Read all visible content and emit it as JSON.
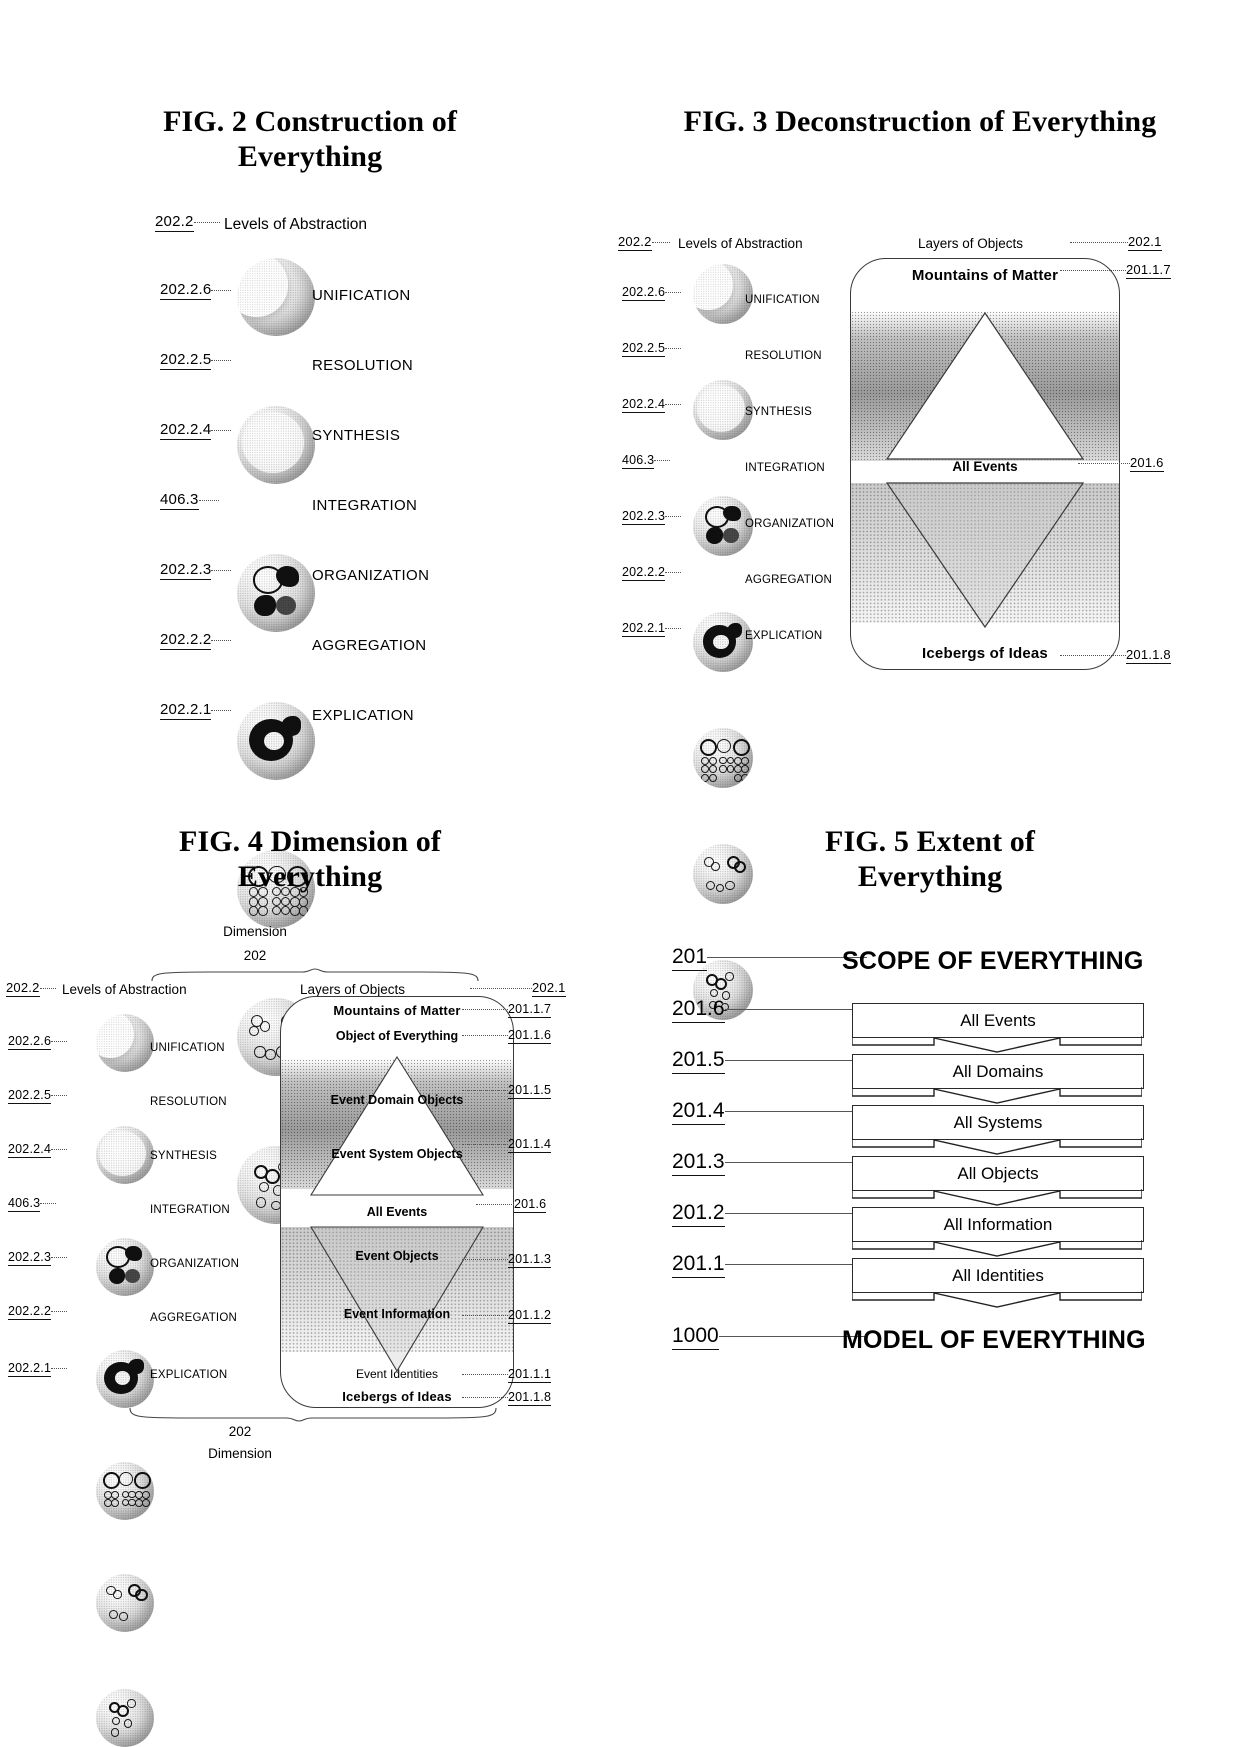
{
  "document": {
    "type": "patent-figure-sheet",
    "figure_count": 4
  },
  "fig2": {
    "title": "FIG. 2 Construction of Everything",
    "column_header": {
      "ref": "202.2",
      "label": "Levels of Abstraction"
    },
    "levels": [
      {
        "ref": "202.2.6",
        "label": "UNIFICATION"
      },
      {
        "ref": "202.2.5",
        "label": "RESOLUTION"
      },
      {
        "ref": "202.2.4",
        "label": "SYNTHESIS"
      },
      {
        "ref": "406.3",
        "label": "INTEGRATION"
      },
      {
        "ref": "202.2.3",
        "label": "ORGANIZATION"
      },
      {
        "ref": "202.2.2",
        "label": "AGGREGATION"
      },
      {
        "ref": "202.2.1",
        "label": "EXPLICATION"
      }
    ]
  },
  "fig3": {
    "title": "FIG. 3 Deconstruction of Everything",
    "left_column": {
      "ref": "202.2",
      "label": "Levels of Abstraction"
    },
    "right_column": {
      "ref": "202.1",
      "label": "Layers of Objects"
    },
    "levels": [
      {
        "ref": "202.2.6",
        "label": "UNIFICATION"
      },
      {
        "ref": "202.2.5",
        "label": "RESOLUTION"
      },
      {
        "ref": "202.2.4",
        "label": "SYNTHESIS"
      },
      {
        "ref": "406.3",
        "label": "INTEGRATION"
      },
      {
        "ref": "202.2.3",
        "label": "ORGANIZATION"
      },
      {
        "ref": "202.2.2",
        "label": "AGGREGATION"
      },
      {
        "ref": "202.2.1",
        "label": "EXPLICATION"
      }
    ],
    "bands": {
      "top_title": "Mountains of Matter",
      "top_ref": "201.1.7",
      "middle_title": "All Events",
      "middle_ref": "201.6",
      "bottom_title": "Icebergs of Ideas",
      "bottom_ref": "201.1.8"
    }
  },
  "fig4": {
    "title": "FIG. 4 Dimension of Everything",
    "dimension_top": {
      "label": "Dimension",
      "ref": "202"
    },
    "dimension_bottom": {
      "ref": "202",
      "label": "Dimension"
    },
    "left_column": {
      "ref": "202.2",
      "label": "Levels of Abstraction"
    },
    "right_column": {
      "ref": "202.1",
      "label": "Layers of Objects"
    },
    "levels": [
      {
        "ref": "202.2.6",
        "label": "UNIFICATION"
      },
      {
        "ref": "202.2.5",
        "label": "RESOLUTION"
      },
      {
        "ref": "202.2.4",
        "label": "SYNTHESIS"
      },
      {
        "ref": "406.3",
        "label": "INTEGRATION"
      },
      {
        "ref": "202.2.3",
        "label": "ORGANIZATION"
      },
      {
        "ref": "202.2.2",
        "label": "AGGREGATION"
      },
      {
        "ref": "202.2.1",
        "label": "EXPLICATION"
      }
    ],
    "layers": [
      {
        "ref": "201.1.7",
        "label": "Mountains of Matter"
      },
      {
        "ref": "201.1.6",
        "label": "Object of Everything"
      },
      {
        "ref": "201.1.5",
        "label": "Event Domain Objects"
      },
      {
        "ref": "201.1.4",
        "label": "Event System Objects"
      },
      {
        "ref": "201.6",
        "label": "All Events"
      },
      {
        "ref": "201.1.3",
        "label": "Event Objects"
      },
      {
        "ref": "201.1.2",
        "label": "Event Information"
      },
      {
        "ref": "201.1.1",
        "label": "Event Identities"
      },
      {
        "ref": "201.1.8",
        "label": "Icebergs of Ideas"
      }
    ]
  },
  "fig5": {
    "title": "FIG. 5 Extent of Everything",
    "scope": {
      "ref": "201",
      "label": "SCOPE OF EVERYTHING"
    },
    "model": {
      "ref": "1000",
      "label": "MODEL OF EVERYTHING"
    },
    "rows": [
      {
        "ref": "201.6",
        "label": "All Events"
      },
      {
        "ref": "201.5",
        "label": "All Domains"
      },
      {
        "ref": "201.4",
        "label": "All Systems"
      },
      {
        "ref": "201.3",
        "label": "All Objects"
      },
      {
        "ref": "201.2",
        "label": "All Information"
      },
      {
        "ref": "201.1",
        "label": "All Identities"
      }
    ]
  }
}
